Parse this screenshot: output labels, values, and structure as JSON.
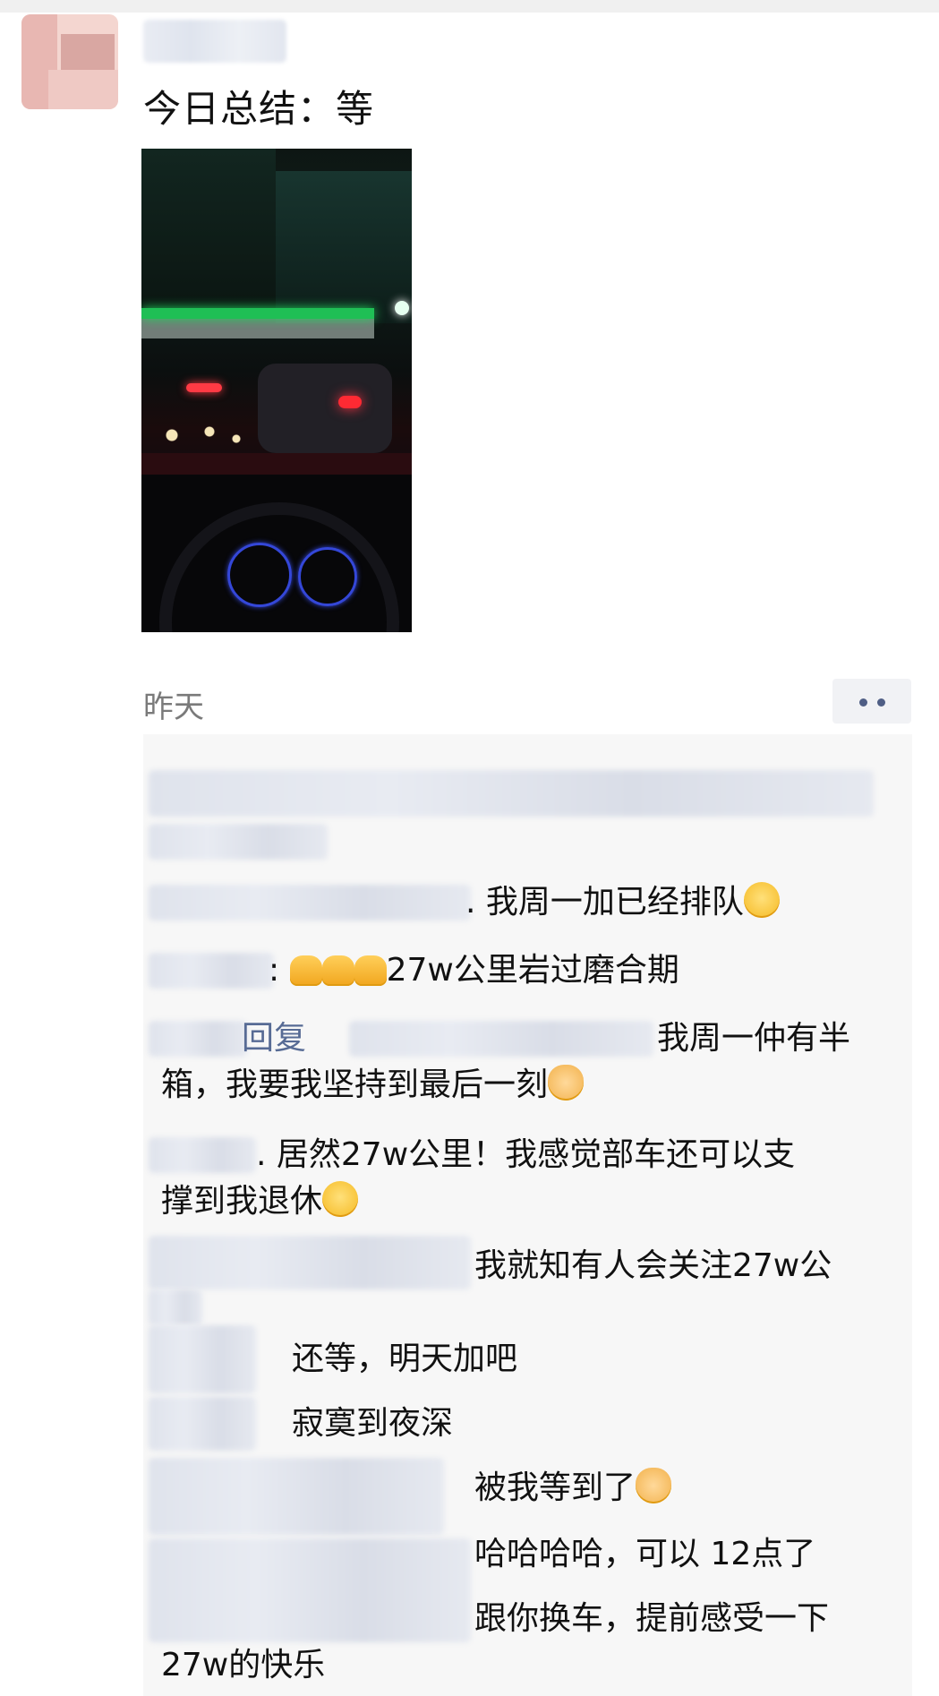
{
  "post": {
    "text": "今日总结：等",
    "time": "昨天"
  },
  "comments": [
    {
      "text": ". 我周一加已经排队",
      "emoji": "laughing-tears-emoji"
    },
    {
      "text": ": ",
      "pray": "pray-emoji",
      "after": "27w公里岩过磨合期"
    },
    {
      "name_end": "回复",
      "text": " 我周一仲有半"
    },
    {
      "text": "箱，我要我坚持到最后一刻",
      "emoji": "doge-emoji"
    },
    {
      "text": ". 居然27w公里！我感觉部车还可以支"
    },
    {
      "text": "撑到我退休",
      "emoji": "smile-emoji"
    },
    {
      "text": "我就知有人会关注27w公"
    },
    {
      "text": "还等，明天加吧"
    },
    {
      "text": "寂寞到夜深"
    },
    {
      "text": "被我等到了",
      "emoji": "doge-emoji"
    },
    {
      "text": "哈哈哈哈，可以 12点了"
    },
    {
      "text": "跟你换车，提前感受一下"
    },
    {
      "text": "27w的快乐"
    }
  ]
}
